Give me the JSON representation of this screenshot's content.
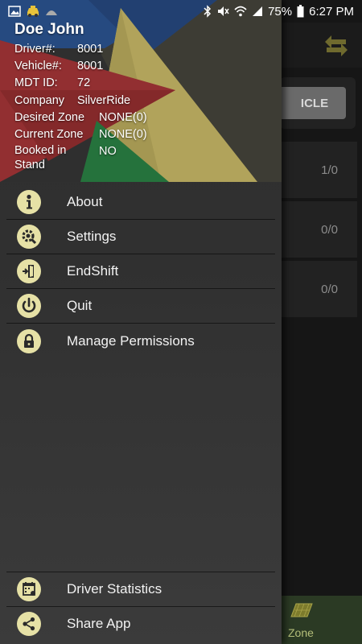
{
  "status_bar": {
    "battery": "75%",
    "time": "6:27 PM"
  },
  "driver": {
    "name": "Doe John",
    "fields": [
      {
        "label": "Driver#:",
        "value": "8001"
      },
      {
        "label": "Vehicle#:",
        "value": "8001"
      },
      {
        "label": "MDT ID:",
        "value": "72"
      },
      {
        "label": "Company",
        "value": "SilverRide"
      }
    ],
    "zone_fields": [
      {
        "label": "Desired Zone",
        "value": "NONE(0)"
      },
      {
        "label": "Current Zone",
        "value": "NONE(0)"
      }
    ],
    "booked": {
      "label": "Booked in Stand",
      "value": "NO"
    }
  },
  "menu": {
    "items": [
      {
        "label": "About",
        "icon": "info-icon"
      },
      {
        "label": "Settings",
        "icon": "settings-icon"
      },
      {
        "label": "EndShift",
        "icon": "end-shift-icon"
      },
      {
        "label": "Quit",
        "icon": "power-icon"
      },
      {
        "label": "Manage Permissions",
        "icon": "lock-icon"
      }
    ],
    "bottom_items": [
      {
        "label": "Driver Statistics",
        "icon": "calendar-stats-icon"
      },
      {
        "label": "Share App",
        "icon": "share-icon"
      }
    ]
  },
  "background": {
    "vehicle_button": "ICLE",
    "rows": [
      "1/0",
      "0/0",
      "0/0"
    ],
    "zone_label": "Zone"
  },
  "colors": {
    "icon_bg": "#e6e1a6",
    "drawer_bg": "#303030",
    "accent_red": "#b23a3c",
    "accent_yellow": "#d8c770",
    "accent_blue": "#2f5b9d",
    "accent_green": "#2e8b4a"
  }
}
